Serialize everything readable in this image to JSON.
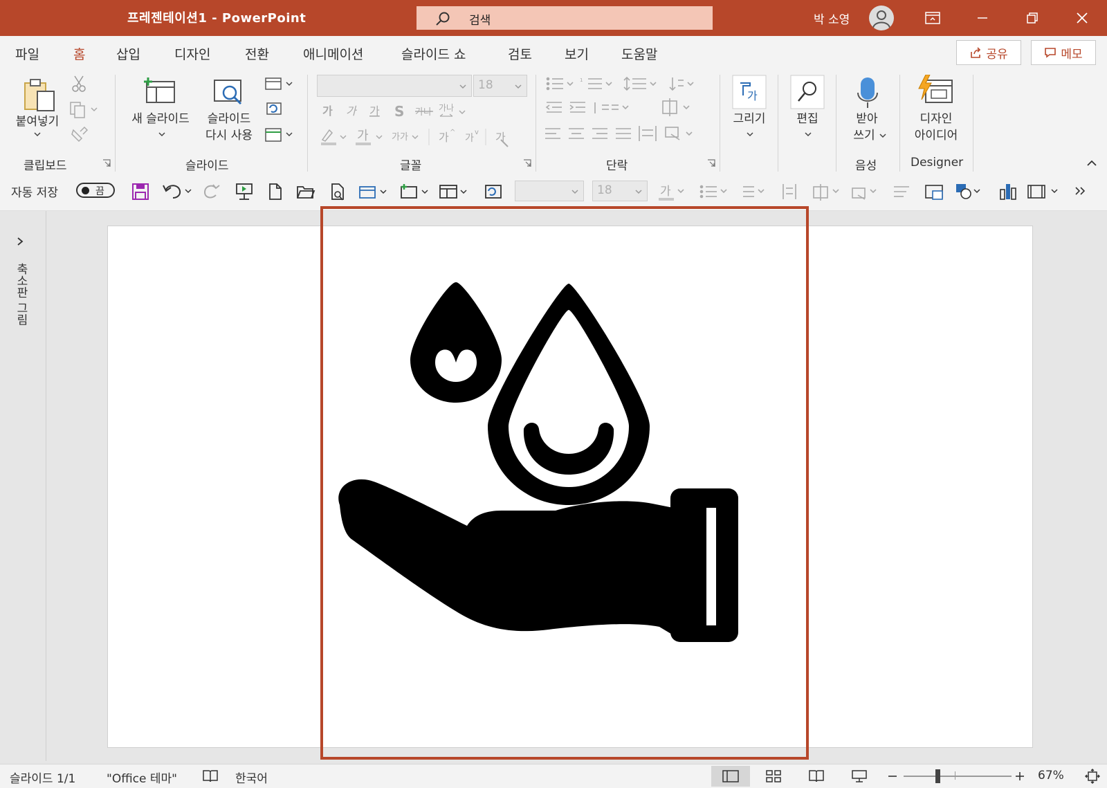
{
  "titlebar": {
    "title": "프레젠테이션1  -  PowerPoint",
    "search_placeholder": "검색",
    "user": "박 소영",
    "bg": "#b7472a"
  },
  "menu": {
    "tabs": [
      "파일",
      "홈",
      "삽입",
      "디자인",
      "전환",
      "애니메이션",
      "슬라이드 쇼",
      "검토",
      "보기",
      "도움말"
    ],
    "active": "홈",
    "share": "공유",
    "memo": "메모"
  },
  "ribbon": {
    "paste": "붙여넣기",
    "new_slide": "새 슬라이드",
    "reuse_slide_1": "슬라이드",
    "reuse_slide_2": "다시 사용",
    "font_size": "18",
    "draw": "그리기",
    "edit": "편집",
    "dictate_1": "받아",
    "dictate_2": "쓰기",
    "designer_1": "디자인",
    "designer_2": "아이디어",
    "groups": {
      "clipboard": "클립보드",
      "slides": "슬라이드",
      "font": "글꼴",
      "paragraph": "단락",
      "voice": "음성",
      "designer": "Designer"
    }
  },
  "qat": {
    "autosave": "자동 저장",
    "toggle": "끔",
    "font_size": "18"
  },
  "sidepane": {
    "label": "축소판 그림"
  },
  "status": {
    "slide": "슬라이드 1/1",
    "theme": "\"Office 테마\"",
    "language": "한국어",
    "zoom": "67%"
  }
}
